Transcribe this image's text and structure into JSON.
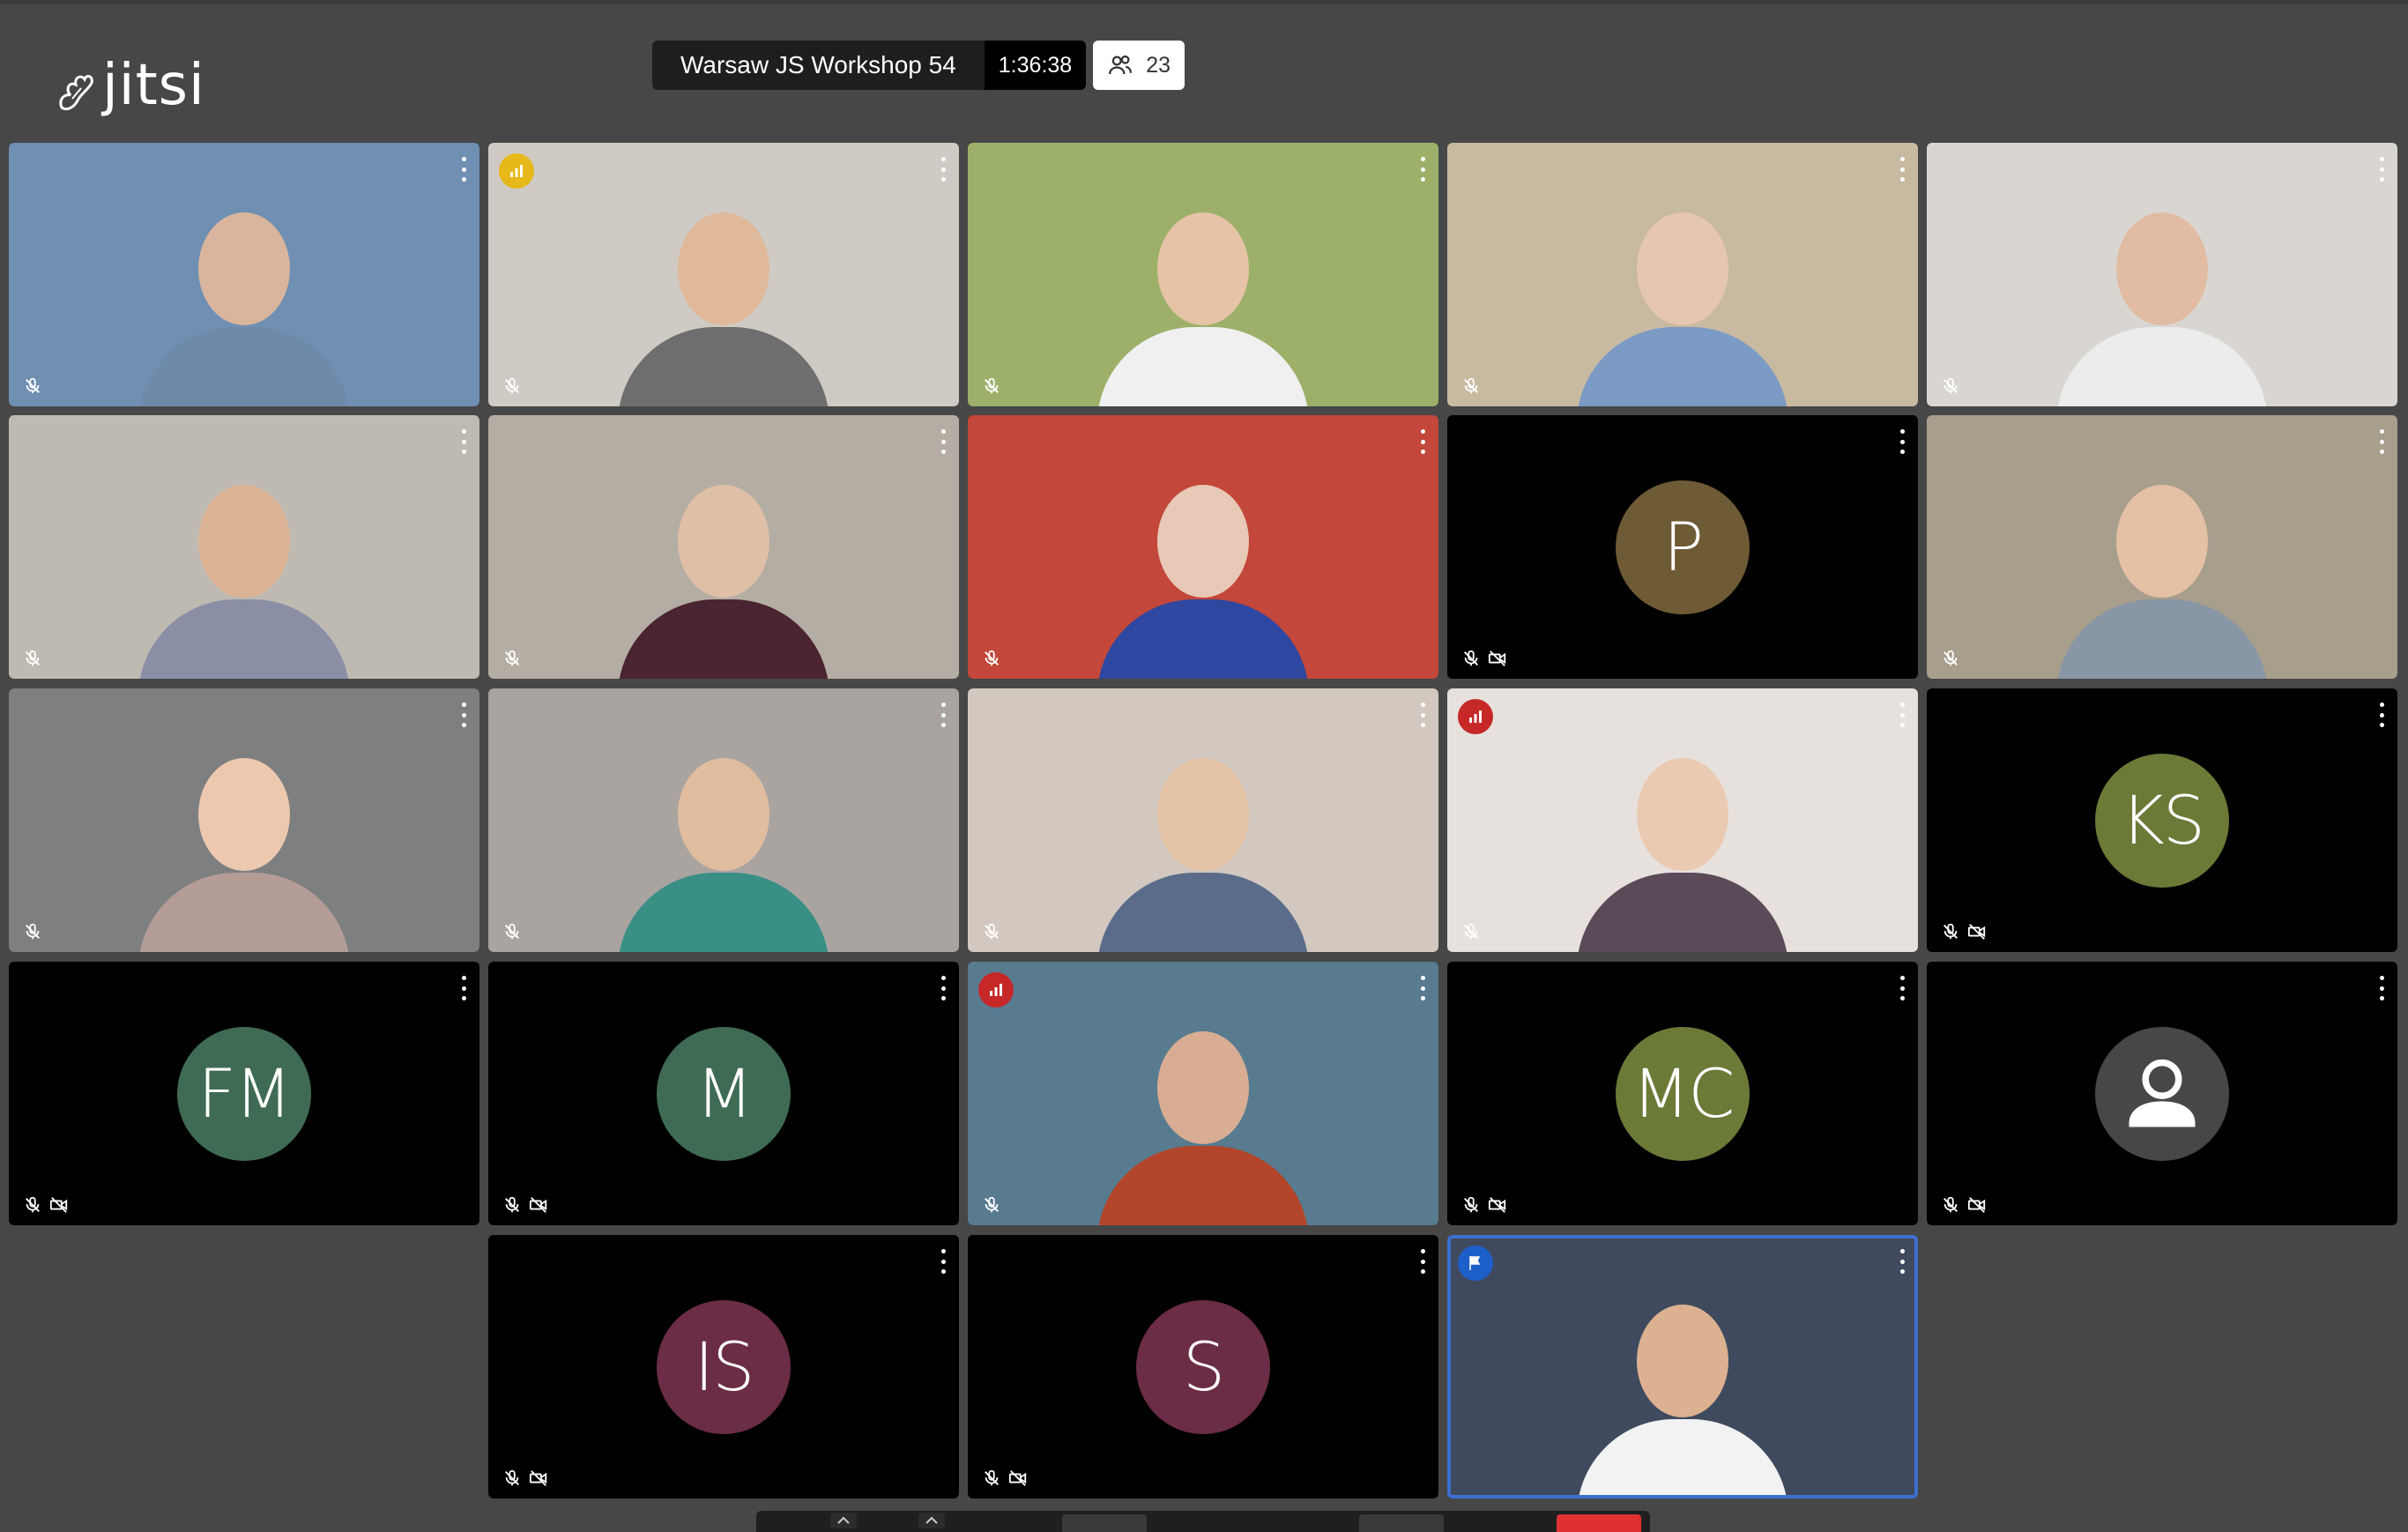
{
  "app": {
    "logo_text": "jitsi"
  },
  "header": {
    "subject": "Warsaw JS Workshop 54",
    "timer": "1:36:38",
    "participant_count": "23"
  },
  "colors": {
    "active_speaker_border": "#3c6fcf",
    "connection_good": "#e7b81a",
    "connection_poor": "#c62828",
    "moderator_badge": "#1d5fc9",
    "hangup": "#e03131"
  },
  "tiles": [
    {
      "id": "t1",
      "type": "video",
      "muted_audio": true,
      "muted_video": false,
      "bg": "#6f8fb3",
      "skin": "#d8b59c",
      "shirt": "#6f8aa8"
    },
    {
      "id": "t2",
      "type": "video",
      "muted_audio": true,
      "muted_video": false,
      "bg": "#cfcac3",
      "skin": "#e0b89a",
      "shirt": "#6e6e6e",
      "indicator": "good"
    },
    {
      "id": "t3",
      "type": "video",
      "muted_audio": true,
      "muted_video": false,
      "bg": "#9db06a",
      "skin": "#e6c3a7",
      "shirt": "#f0f0f0"
    },
    {
      "id": "t4",
      "type": "video",
      "muted_audio": true,
      "muted_video": false,
      "bg": "#c8b9a1",
      "skin": "#e6c6b0",
      "shirt": "#7b9ac4"
    },
    {
      "id": "t5",
      "type": "video",
      "muted_audio": true,
      "muted_video": false,
      "bg": "#d9d6d2",
      "skin": "#e1bca3",
      "shirt": "#ececec"
    },
    {
      "id": "t6",
      "type": "video",
      "muted_audio": true,
      "muted_video": false,
      "bg": "#bfbab1",
      "skin": "#dbb394",
      "shirt": "#8b8fa6"
    },
    {
      "id": "t7",
      "type": "video",
      "muted_audio": true,
      "muted_video": false,
      "bg": "#b4ada3",
      "skin": "#e0bfa7",
      "shirt": "#4a2430"
    },
    {
      "id": "t8",
      "type": "video",
      "muted_audio": true,
      "muted_video": false,
      "bg": "#c3473a",
      "skin": "#e8c8b6",
      "shirt": "#2e47a0"
    },
    {
      "id": "t9",
      "type": "avatar",
      "initials": "P",
      "avatar_color": "#6e5a35",
      "muted_audio": true,
      "muted_video": true
    },
    {
      "id": "t10",
      "type": "video",
      "muted_audio": true,
      "muted_video": false,
      "bg": "#a79e8c",
      "skin": "#e4c0a4",
      "shirt": "#8996a6"
    },
    {
      "id": "t11",
      "type": "video",
      "muted_audio": true,
      "muted_video": false,
      "bg": "#7e7f80",
      "skin": "#ecc8af",
      "shirt": "#b39d96"
    },
    {
      "id": "t12",
      "type": "video",
      "muted_audio": true,
      "muted_video": false,
      "bg": "#a9a4a0",
      "skin": "#e0bd9f",
      "shirt": "#3a8f85"
    },
    {
      "id": "t13",
      "type": "video",
      "muted_audio": true,
      "muted_video": false,
      "bg": "#d2c8bf",
      "skin": "#e5c3a6",
      "shirt": "#5a6c8a"
    },
    {
      "id": "t14",
      "type": "video",
      "muted_audio": true,
      "muted_video": false,
      "bg": "#e6e1dc",
      "skin": "#ebcab3",
      "shirt": "#5b4a57",
      "indicator": "poor"
    },
    {
      "id": "t15",
      "type": "avatar",
      "initials": "KS",
      "avatar_color": "#6b7a37",
      "muted_audio": true,
      "muted_video": true
    },
    {
      "id": "t16",
      "type": "avatar",
      "initials": "FM",
      "avatar_color": "#3f6b54",
      "muted_audio": true,
      "muted_video": true
    },
    {
      "id": "t17",
      "type": "avatar",
      "initials": "M",
      "avatar_color": "#3f6b54",
      "muted_audio": true,
      "muted_video": true
    },
    {
      "id": "t18",
      "type": "video",
      "muted_audio": true,
      "muted_video": false,
      "bg": "#587b8f",
      "skin": "#d8ad93",
      "shirt": "#b3462a",
      "indicator": "poor"
    },
    {
      "id": "t19",
      "type": "avatar",
      "initials": "MC",
      "avatar_color": "#6b7a37",
      "muted_audio": true,
      "muted_video": true
    },
    {
      "id": "t20",
      "type": "avatar",
      "initials": "",
      "avatar_color": "#474747",
      "icon": "user-icon",
      "muted_audio": true,
      "muted_video": true
    },
    {
      "id": "t21",
      "type": "avatar",
      "initials": "IS",
      "avatar_color": "#6b2c45",
      "muted_audio": true,
      "muted_video": true
    },
    {
      "id": "t22",
      "type": "avatar",
      "initials": "S",
      "avatar_color": "#6b2c45",
      "muted_audio": true,
      "muted_video": true
    },
    {
      "id": "t23",
      "type": "video",
      "muted_audio": false,
      "muted_video": false,
      "bg": "#3f4a5e",
      "skin": "#dcb191",
      "shirt": "#f2f2f2",
      "indicator": "moderator",
      "active": true
    }
  ]
}
